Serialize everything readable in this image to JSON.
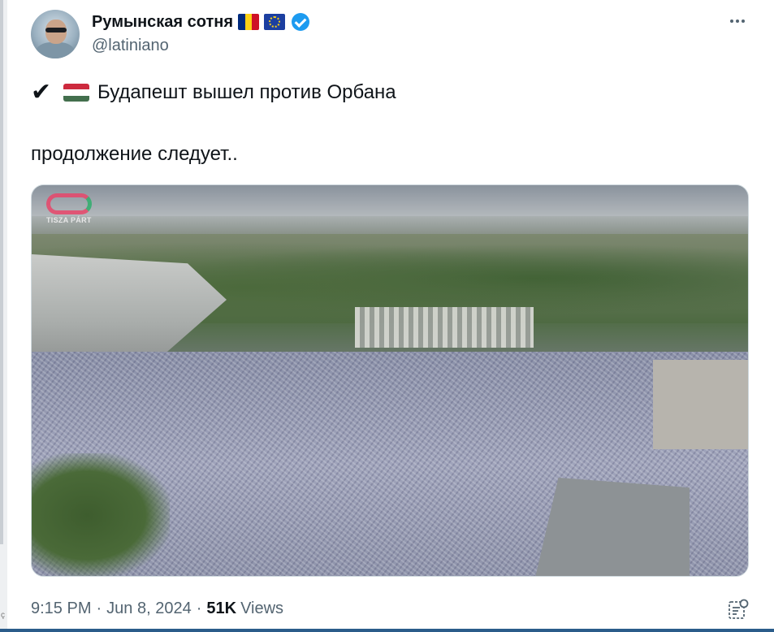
{
  "author": {
    "display_name": "Румынская сотня",
    "handle": "@latiniano",
    "flags": [
      "flag-romania-icon",
      "flag-eu-icon"
    ],
    "verified_icon": "verified-badge-icon"
  },
  "tweet": {
    "line1_icon": "check-mark-icon",
    "line1_check": "✔",
    "line1_flag": "flag-hungary-icon",
    "line1_text": "Будапешт вышел против Орбана",
    "line2_text": "продолжение следует.."
  },
  "media": {
    "watermark_text": "TISZA PÁRT"
  },
  "meta": {
    "time": "9:15 PM",
    "date": "Jun 8, 2024",
    "separator": "·",
    "views_count": "51K",
    "views_label": "Views"
  },
  "colors": {
    "accent_blue": "#1d9bf0",
    "text_primary": "#0f1419",
    "text_secondary": "#536471",
    "hungary_red": "#cd2a3e",
    "hungary_green": "#436f4d",
    "romania_blue": "#002b7f",
    "romania_yellow": "#fcd116",
    "romania_red": "#ce1126"
  }
}
